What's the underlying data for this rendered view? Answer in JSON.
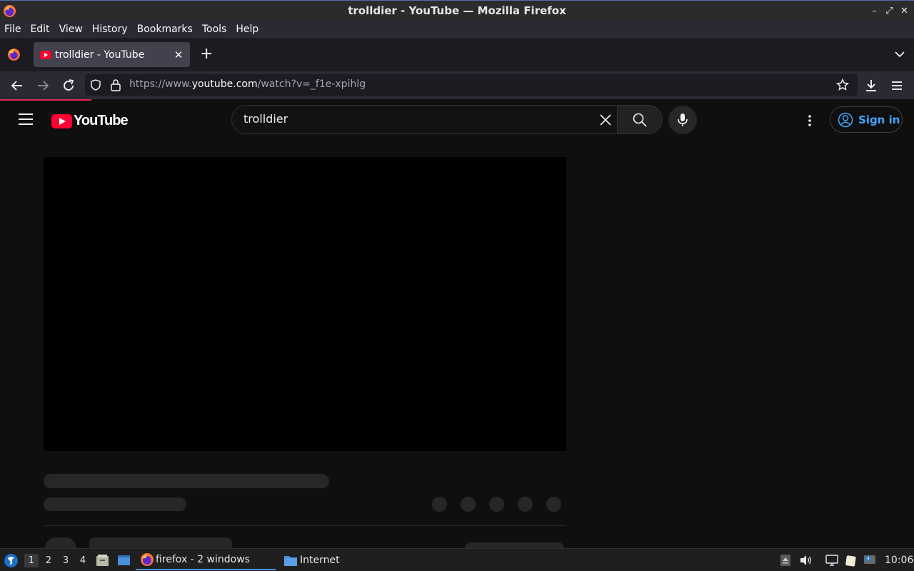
{
  "window": {
    "title": "trolldier - YouTube — Mozilla Firefox",
    "controls": [
      "–",
      "⤢",
      "✕"
    ]
  },
  "menubar": {
    "items": [
      "File",
      "Edit",
      "View",
      "History",
      "Bookmarks",
      "Tools",
      "Help"
    ]
  },
  "tabs": [
    {
      "title": "trolldier - YouTube",
      "close": "✕"
    }
  ],
  "newtab_label": "+",
  "urlbar": {
    "prefix": "https://www.",
    "domain": "youtube.com",
    "path": "/watch?v=_f1e-xpihlg"
  },
  "youtube": {
    "logo_text": "YouTube",
    "search_value": "trolldier",
    "signin_label": "Sign in"
  },
  "taskbar": {
    "workspaces": [
      "1",
      "2",
      "3",
      "4"
    ],
    "active_workspace": "1",
    "tasks": [
      {
        "label": "firefox - 2 windows",
        "active": true
      },
      {
        "label": "Internet",
        "active": false
      }
    ],
    "clock": "10:06"
  },
  "colors": {
    "accent_link": "#3ea6ff",
    "youtube_red": "#ff0033",
    "page_bg": "#0f0f0f",
    "load_progress": "#e22850"
  }
}
